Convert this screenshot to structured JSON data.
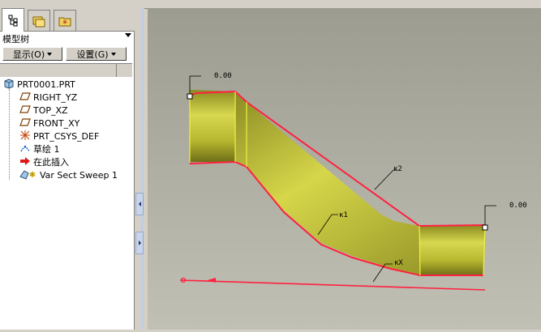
{
  "tabs": [
    {
      "icon": "model-tree-icon",
      "active": true
    },
    {
      "icon": "folder-browser-icon",
      "active": false
    },
    {
      "icon": "favorites-icon",
      "active": false
    }
  ],
  "panel": {
    "title": "模型树",
    "show_label": "显示(O)",
    "settings_label": "设置(G)"
  },
  "tree": {
    "root": "PRT0001.PRT",
    "items": [
      {
        "label": "RIGHT_YZ",
        "icon": "datum-plane-icon"
      },
      {
        "label": "TOP_XZ",
        "icon": "datum-plane-icon"
      },
      {
        "label": "FRONT_XY",
        "icon": "datum-plane-icon"
      },
      {
        "label": "PRT_CSYS_DEF",
        "icon": "coordinate-system-icon"
      },
      {
        "label": "草绘 1",
        "icon": "sketch-icon"
      },
      {
        "label": "在此插入",
        "icon": "insert-here-arrow-icon"
      },
      {
        "label": "Var Sect Sweep 1",
        "icon": "variable-section-sweep-icon"
      }
    ]
  },
  "viewport": {
    "background_color": "#a8a89c",
    "solid_color": "#c8c832",
    "edge_color": "#e8203c",
    "annotations": {
      "left_dim": "0.00",
      "right_dim": "0.00",
      "trajectory_top": "κ2",
      "trajectory_middle": "κ1",
      "trajectory_bottom": "κX"
    }
  }
}
